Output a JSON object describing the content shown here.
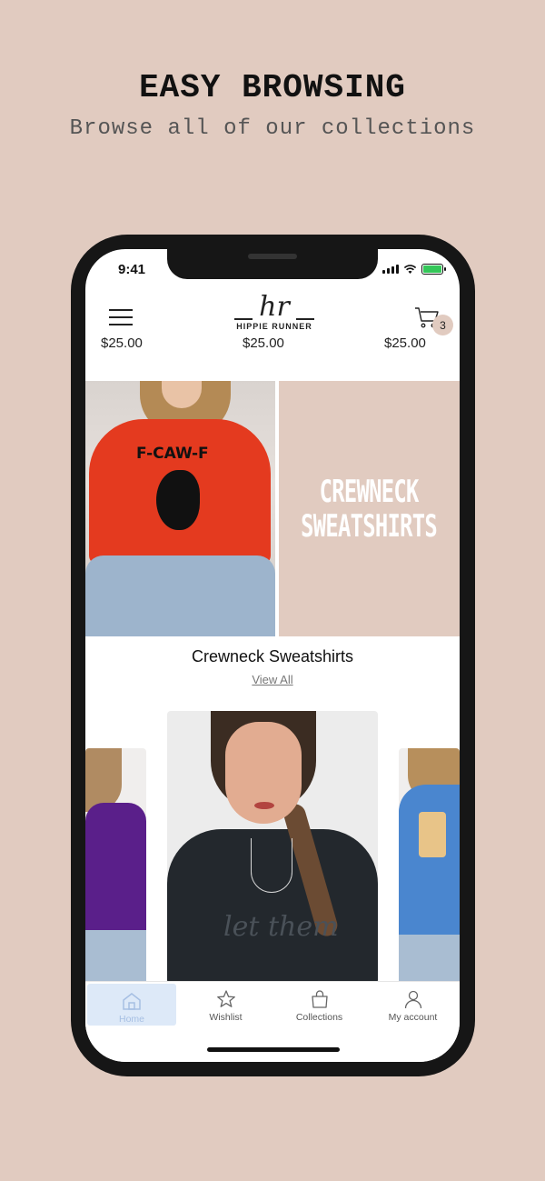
{
  "promo": {
    "title": "EASY BROWSING",
    "subtitle": "Browse all of our collections"
  },
  "status_bar": {
    "time": "9:41"
  },
  "header": {
    "logo_mark": "hr",
    "logo_text": "HIPPIE RUNNER",
    "cart_count": "3",
    "prices": {
      "left": "$25.00",
      "center": "$25.00",
      "right": "$25.00"
    }
  },
  "banner": {
    "panel_text_line1": "CREWNECK",
    "panel_text_line2": "SWEATSHIRTS",
    "print_text": "F-CAW-F"
  },
  "collection": {
    "title": "Crewneck Sweatshirts",
    "view_all": "View All"
  },
  "tabs": [
    {
      "label": "Home",
      "icon": "home-icon",
      "active": true
    },
    {
      "label": "Wishlist",
      "icon": "star-icon"
    },
    {
      "label": "Collections",
      "icon": "bag-icon"
    },
    {
      "label": "My account",
      "icon": "user-icon"
    }
  ],
  "colors": {
    "background": "#e1cbc0",
    "accent": "#e1cbc0",
    "active_tab": "#dde9f8"
  }
}
